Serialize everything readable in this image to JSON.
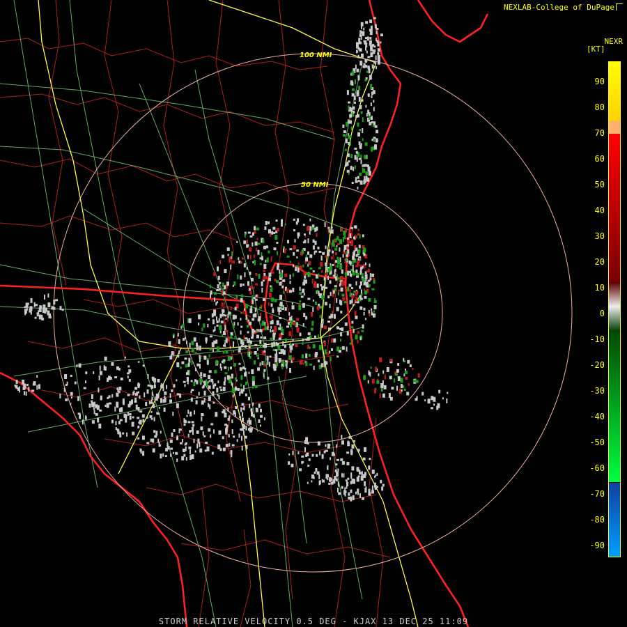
{
  "header": {
    "credit": "NEXLAB-College of DuPage",
    "product": "NEXR",
    "units": "[KT]"
  },
  "range_rings": [
    {
      "label": "100 NMI"
    },
    {
      "label": "50 NMI"
    }
  ],
  "legend": {
    "ticks": [
      "90",
      "80",
      "70",
      "60",
      "50",
      "40",
      "30",
      "20",
      "10",
      "0",
      "-10",
      "-20",
      "-30",
      "-40",
      "-50",
      "-60",
      "-70",
      "-80",
      "-90"
    ]
  },
  "footer": {
    "caption": "STORM RELATIVE VELOCITY 0.5 DEG - KJAX 13 DEC 25 11:09"
  },
  "colors": {
    "background": "#000000",
    "coastline": "#ff2020",
    "county_lines": "#cc2222",
    "highways": "#ffff40",
    "roads": "#7fcf7f",
    "range_rings": "#f0b0a0",
    "labels": "#ffff00",
    "echo_gray": "#c8c8c8",
    "echo_green": "#1aa01a",
    "echo_red": "#c01a1a"
  }
}
